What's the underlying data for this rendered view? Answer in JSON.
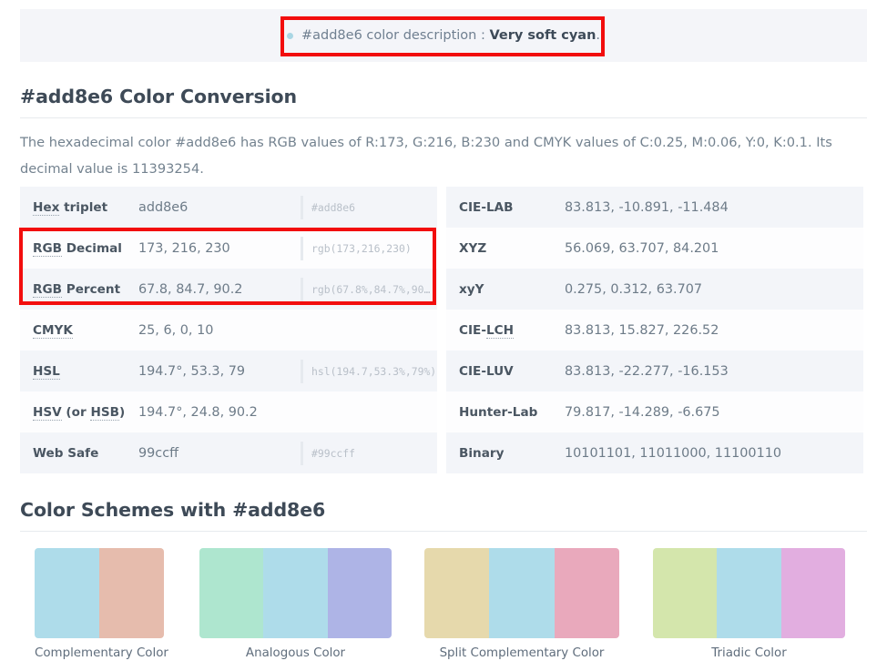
{
  "banner": {
    "bullet_icon": "bullet-dot-icon",
    "prefix": "#add8e6 color description : ",
    "emphasis": "Very soft cyan",
    "suffix": ".",
    "highlight_color": "#f20d0d",
    "background": "#f4f5f9"
  },
  "conversion": {
    "heading": "#add8e6 Color Conversion",
    "intro": "The hexadecimal color #add8e6 has RGB values of R:173, G:216, B:230 and CMYK values of C:0.25, M:0.06, Y:0, K:0.1. Its decimal value is 11393254.",
    "left_rows": [
      {
        "label": "Hex triplet",
        "abbr": "Hex",
        "rest": " triplet",
        "value": "add8e6",
        "css": "#add8e6"
      },
      {
        "label": "RGB Decimal",
        "abbr": "RGB",
        "rest": " Decimal",
        "value": "173, 216, 230",
        "css": "rgb(173,216,230)"
      },
      {
        "label": "RGB Percent",
        "abbr": "RGB",
        "rest": " Percent",
        "value": "67.8, 84.7, 90.2",
        "css": "rgb(67.8%,84.7%,90…"
      },
      {
        "label": "CMYK",
        "abbr": "CMYK",
        "rest": "",
        "value": "25, 6, 0, 10",
        "css": ""
      },
      {
        "label": "HSL",
        "abbr": "HSL",
        "rest": "",
        "value": "194.7°, 53.3, 79",
        "css": "hsl(194.7,53.3%,79%)"
      },
      {
        "label": "HSV (or HSB)",
        "abbr": "HSV",
        "rest": " (or HSB)",
        "value": "194.7°, 24.8, 90.2",
        "css": ""
      },
      {
        "label": "Web Safe",
        "abbr": "",
        "rest": "Web Safe",
        "value": "99ccff",
        "css": "#99ccff"
      }
    ],
    "right_rows": [
      {
        "label": "CIE-LAB",
        "abbr": "",
        "rest": "CIE-LAB",
        "value": "83.813, -10.891, -11.484",
        "css": ""
      },
      {
        "label": "XYZ",
        "abbr": "",
        "rest": "XYZ",
        "value": "56.069, 63.707, 84.201",
        "css": ""
      },
      {
        "label": "xyY",
        "abbr": "",
        "rest": "xyY",
        "value": "0.275, 0.312, 63.707",
        "css": ""
      },
      {
        "label": "CIE-LCH",
        "abbr": "LCH",
        "rest": "",
        "prefix": "CIE-",
        "value": "83.813, 15.827, 226.52",
        "css": ""
      },
      {
        "label": "CIE-LUV",
        "abbr": "",
        "rest": "CIE-LUV",
        "value": "83.813, -22.277, -16.153",
        "css": ""
      },
      {
        "label": "Hunter-Lab",
        "abbr": "",
        "rest": "Hunter-Lab",
        "value": "79.817, -14.289, -6.675",
        "css": ""
      },
      {
        "label": "Binary",
        "abbr": "",
        "rest": "Binary",
        "value": "10101101, 11011000, 11100110",
        "css": ""
      }
    ]
  },
  "schemes": {
    "heading": "Color Schemes with #add8e6",
    "items": [
      {
        "caption": "Complementary Color",
        "colors": [
          "#aedcea",
          "#e6bcad"
        ]
      },
      {
        "caption": "Analogous Color",
        "colors": [
          "#aee6cf",
          "#aedcea",
          "#aeb4e6"
        ]
      },
      {
        "caption": "Split Complementary Color",
        "colors": [
          "#e6d9ac",
          "#aedcea",
          "#e9a9bc"
        ]
      },
      {
        "caption": "Triadic Color",
        "colors": [
          "#d4e6ac",
          "#aedcea",
          "#e2aee0"
        ]
      }
    ]
  }
}
